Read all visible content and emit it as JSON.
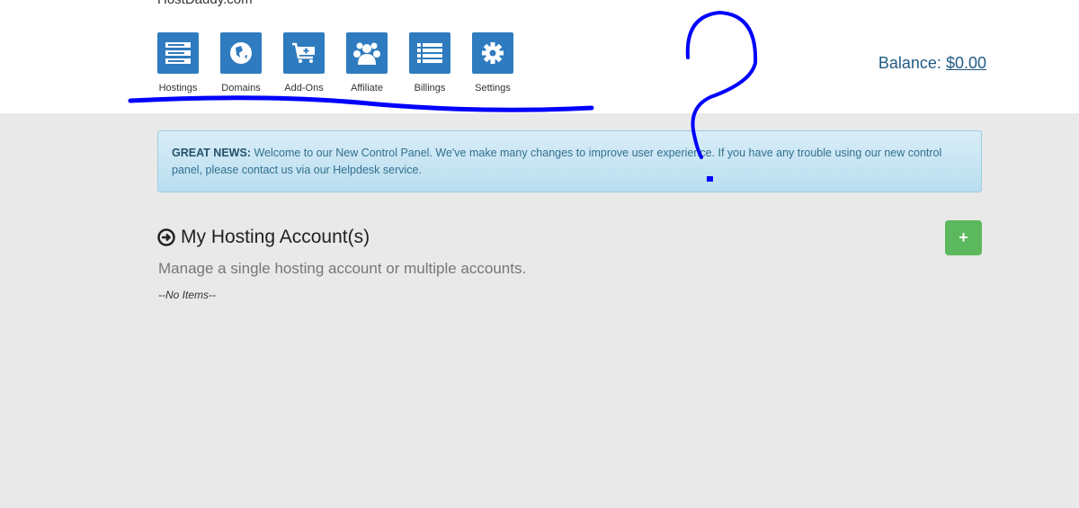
{
  "header": {
    "site_name": "HostDaddy.com",
    "balance_label": "Balance:",
    "balance_value": "$0.00"
  },
  "nav": [
    {
      "label": "Hostings",
      "icon": "server-icon"
    },
    {
      "label": "Domains",
      "icon": "globe-icon"
    },
    {
      "label": "Add-Ons",
      "icon": "cart-plus-icon"
    },
    {
      "label": "Affiliate",
      "icon": "users-icon"
    },
    {
      "label": "Billings",
      "icon": "list-icon"
    },
    {
      "label": "Settings",
      "icon": "gear-icon"
    }
  ],
  "alert": {
    "strong": "GREAT NEWS:",
    "text": " Welcome to our New Control Panel. We've make many changes to improve user experience. If you have any trouble using our new control panel, please contact us via our Helpdesk service."
  },
  "section": {
    "title": "My Hosting Account(s)",
    "subtitle": "Manage a single hosting account or multiple accounts.",
    "empty": "--No Items--",
    "add_label": "+"
  },
  "colors": {
    "tile": "#2f7bbf",
    "add": "#5cb85c",
    "annotation": "#0000ff"
  }
}
